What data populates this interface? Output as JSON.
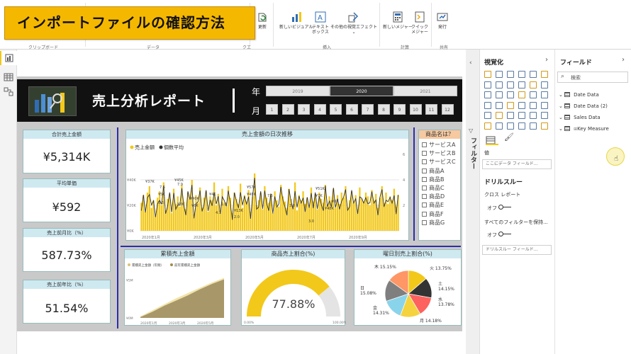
{
  "banner": {
    "text": "インポートファイルの確認方法"
  },
  "ribbon": {
    "groups": {
      "clipboard": "クリップボード",
      "data": "データ",
      "queries": "クエ",
      "insert": "挿入",
      "calc": "計算",
      "share": "共有"
    },
    "buttons": [
      {
        "id": "refresh",
        "label": "更新"
      },
      {
        "id": "new-visual",
        "label": "新しいビジュアル"
      },
      {
        "id": "textbox",
        "label": "テキスト\nボックス"
      },
      {
        "id": "more-visuals",
        "label": "その他の視覚エフェクト"
      },
      {
        "id": "new-measure",
        "label": "新しいメジャー"
      },
      {
        "id": "quick-measure",
        "label": "クイック\nメジャー"
      },
      {
        "id": "publish",
        "label": "発行"
      }
    ]
  },
  "report": {
    "title": "売上分析レポート",
    "year_label": "年",
    "month_label": "月",
    "years": [
      "2019",
      "2020",
      "2021"
    ],
    "selected_year": "2020",
    "months": [
      "1",
      "2",
      "3",
      "4",
      "5",
      "6",
      "7",
      "8",
      "9",
      "10",
      "11",
      "12"
    ]
  },
  "cards": [
    {
      "label": "合計売上金額",
      "value": "¥5,314K"
    },
    {
      "label": "平均単価",
      "value": "¥592"
    },
    {
      "label": "売上前月比（%）",
      "value": "587.73%"
    },
    {
      "label": "売上前年比（%）",
      "value": "51.54%"
    }
  ],
  "slicer": {
    "title": "商品名は？",
    "items": [
      "サービスA",
      "サービスB",
      "サービスC",
      "商品A",
      "商品B",
      "商品C",
      "商品D",
      "商品E",
      "商品F",
      "商品G"
    ]
  },
  "colors": {
    "accent": "#f2c81a",
    "line": "#333333",
    "header_bg": "#cfe9f1",
    "slicer_header": "#f6c9a0"
  },
  "chart_data": [
    {
      "type": "bar",
      "title": "売上金額の日次推移",
      "legend": [
        "売上金額",
        "個数平均"
      ],
      "legend_position": "top-left",
      "yticks_left": [
        "¥0K",
        "¥20K",
        "¥40K"
      ],
      "yticks_right": [
        "2",
        "4",
        "6"
      ],
      "xticks": [
        "2020年1月",
        "2020年3月",
        "2020年5月",
        "2020年7月",
        "2020年9月"
      ],
      "annotations": [
        "¥37K",
        "7.5",
        "¥45K",
        "7.9",
        "¥5K",
        "3.3",
        "¥8K",
        "¥6K",
        "¥40K",
        "¥4K",
        "1.3",
        "4.1",
        "¥13K",
        "2.0",
        "¥57K",
        "¥48K",
        "7.5",
        "3.8",
        "¥51K",
        "¥7K",
        "3.0",
        "¥48K",
        "¥8K"
      ],
      "values": [
        22,
        28,
        15,
        30,
        35,
        18,
        24,
        12,
        26,
        31,
        20,
        38,
        16,
        25,
        29,
        14,
        33,
        21,
        27,
        19,
        36,
        23,
        17,
        30,
        25,
        40,
        13,
        28,
        22,
        34,
        18,
        26,
        31,
        15,
        27,
        24,
        38,
        20,
        29,
        16,
        33,
        22,
        19,
        35,
        26,
        14,
        30,
        25,
        21,
        37,
        18,
        28,
        23,
        32,
        15,
        27,
        45,
        20,
        24,
        30,
        17,
        35,
        26,
        22,
        29,
        14,
        31,
        24,
        19,
        36,
        27,
        23,
        18,
        33,
        25,
        20,
        38,
        16,
        28,
        24,
        31,
        21,
        26,
        19,
        34,
        23,
        29,
        17,
        30,
        25,
        22,
        36,
        20,
        27,
        24,
        33,
        18,
        28,
        21,
        30,
        26,
        35,
        19,
        24,
        31,
        22,
        28,
        17,
        34,
        25,
        23,
        30,
        27,
        20,
        32,
        24,
        29,
        18,
        26,
        35,
        22,
        30,
        21,
        27,
        24,
        33,
        19,
        28
      ]
    },
    {
      "type": "area",
      "title": "累積売上金額",
      "legend": [
        "累積売上金額（年間）",
        "前年累積売上金額"
      ],
      "yticks": [
        "¥0M",
        "¥5M"
      ],
      "xticks": [
        "2020年1月",
        "2020年3月",
        "2020年5月"
      ],
      "values": [
        0.1,
        0.8,
        1.6,
        2.3,
        3.0,
        3.8,
        4.5,
        5.1
      ],
      "prev_values": [
        0.2,
        1.0,
        1.8,
        2.6,
        3.3,
        4.0,
        4.7,
        5.3
      ]
    },
    {
      "type": "gauge",
      "title": "商品売上割合(%)",
      "value": 77.88,
      "display": "77.88%",
      "min_label": "0.00%",
      "max_label": "100.00%"
    },
    {
      "type": "pie",
      "title": "曜日別売上割合(%)",
      "slices": [
        {
          "name": "火",
          "value": 13.75,
          "label": "火 13.75%",
          "color": "#f2c81a"
        },
        {
          "name": "土",
          "value": 14.15,
          "label": "土\n14.15%",
          "color": "#333333"
        },
        {
          "name": "水",
          "value": 13.78,
          "label": "水\n13.78%",
          "color": "#fd625e"
        },
        {
          "name": "月",
          "value": 14.18,
          "label": "月 14.18%",
          "color": "#f5d33f"
        },
        {
          "name": "金",
          "value": 14.31,
          "label": "金\n14.31%",
          "color": "#8ad4eb"
        },
        {
          "name": "日",
          "value": 15.08,
          "label": "日\n15.08%",
          "color": "#7f7f7f"
        },
        {
          "name": "木",
          "value": 15.15,
          "label": "木 15.15%",
          "color": "#fe9666"
        }
      ]
    }
  ],
  "viz_pane": {
    "title": "視覚化",
    "values_label": "値",
    "values_placeholder": "ここにデータ フィールド...",
    "drill_title": "ドリルスルー",
    "cross_report": "クロス レポート",
    "off1": "オフ",
    "keep_filters": "すべてのフィルターを保持...",
    "off2": "オフ",
    "drill_placeholder": "ドリルスルー フィールド..."
  },
  "filter_strip": {
    "label": "フィルター"
  },
  "fields_pane": {
    "title": "フィールド",
    "search_placeholder": "検索",
    "tables": [
      "Date Data",
      "Date Data (2)",
      "Sales Data",
      "Key Measure"
    ]
  }
}
